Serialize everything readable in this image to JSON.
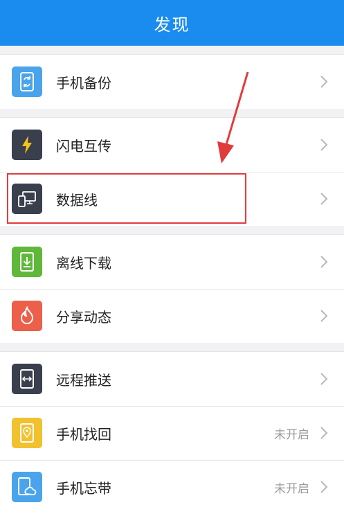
{
  "header": {
    "title": "发现"
  },
  "groups": [
    {
      "items": [
        {
          "label": "手机备份",
          "icon": "phone-sync-icon",
          "color": "#4aa4ec",
          "status": ""
        }
      ]
    },
    {
      "items": [
        {
          "label": "闪电互传",
          "icon": "lightning-icon",
          "color": "#3a3f4d",
          "status": ""
        },
        {
          "label": "数据线",
          "icon": "devices-icon",
          "color": "#3a3f4d",
          "status": ""
        }
      ]
    },
    {
      "items": [
        {
          "label": "离线下载",
          "icon": "download-icon",
          "color": "#5fb83a",
          "status": ""
        },
        {
          "label": "分享动态",
          "icon": "flame-icon",
          "color": "#ec5f4a",
          "status": ""
        }
      ]
    },
    {
      "items": [
        {
          "label": "远程推送",
          "icon": "remote-push-icon",
          "color": "#3a3f4d",
          "status": ""
        },
        {
          "label": "手机找回",
          "icon": "location-pin-icon",
          "color": "#f2c12e",
          "status": "未开启"
        },
        {
          "label": "手机忘带",
          "icon": "phone-cloud-icon",
          "color": "#4aa4ec",
          "status": "未开启"
        }
      ]
    }
  ],
  "annotation": {
    "highlight_color": "#e23b3b"
  }
}
